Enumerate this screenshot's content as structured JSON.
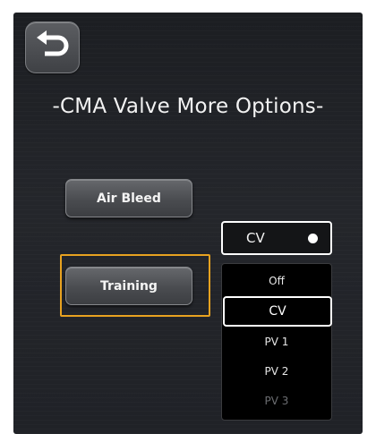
{
  "header": {
    "back_icon": "back-arrow-icon",
    "title": "-CMA Valve More Options-"
  },
  "buttons": {
    "air_bleed": "Air Bleed",
    "training": "Training"
  },
  "mode_select": {
    "selected_value": "CV",
    "options": [
      {
        "label": "Off",
        "state": "normal"
      },
      {
        "label": "CV",
        "state": "selected"
      },
      {
        "label": "PV 1",
        "state": "normal"
      },
      {
        "label": "PV 2",
        "state": "normal"
      },
      {
        "label": "PV 3",
        "state": "disabled"
      }
    ]
  },
  "colors": {
    "highlight": "#e8a220",
    "background": "#202227",
    "text": "#ffffff"
  }
}
